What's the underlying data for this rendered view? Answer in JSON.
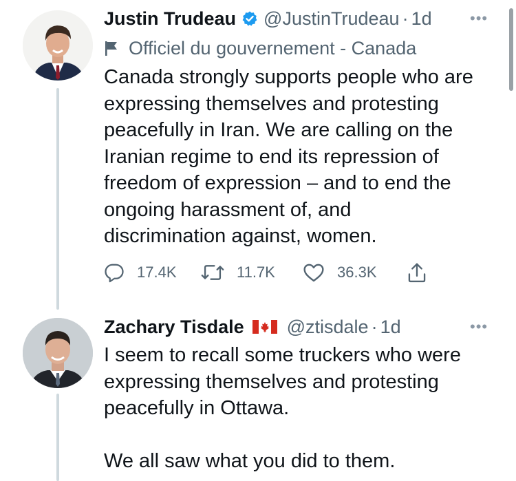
{
  "tweets": [
    {
      "name": "Justin Trudeau",
      "handle": "@JustinTrudeau",
      "time": "1d",
      "verified": true,
      "label": "Officiel du gouvernement - Canada",
      "text_lines": [
        "Canada strongly supports people who are",
        "expressing themselves and protesting",
        "peacefully in Iran. We are calling on the",
        "Iranian regime to end its repression of",
        "freedom of expression – and to end the",
        "ongoing harassment of, and",
        "discrimination against, women."
      ],
      "stats": {
        "replies": "17.4K",
        "retweets": "11.7K",
        "likes": "36.3K"
      }
    },
    {
      "name": "Zachary Tisdale",
      "handle": "@ztisdale",
      "time": "1d",
      "flag": "canada-flag",
      "text_lines": [
        "I seem to recall some truckers who were",
        "expressing themselves and protesting",
        "peacefully in Ottawa.",
        "",
        "We all saw what you did to them."
      ]
    }
  ],
  "ui": {
    "separator": "·",
    "more": "•••"
  },
  "colors": {
    "verified": "#1d9bf0",
    "secondary_text": "#536471",
    "thread_line": "#cfd9de",
    "flag_red": "#d52b1e"
  },
  "icons": [
    "verified-badge-icon",
    "flag-icon",
    "reply-icon",
    "retweet-icon",
    "like-icon",
    "share-icon",
    "more-icon"
  ]
}
